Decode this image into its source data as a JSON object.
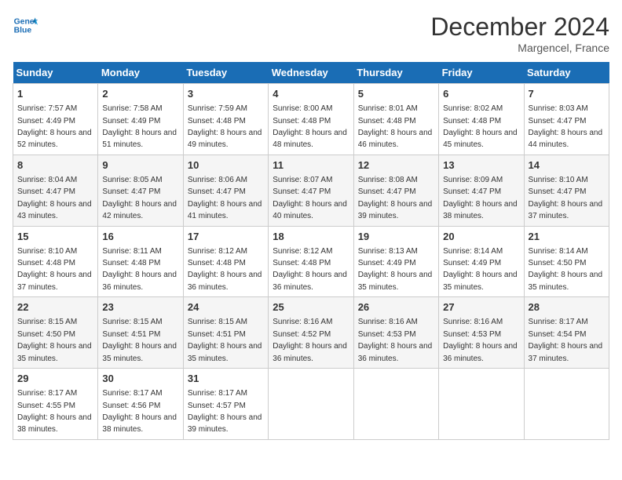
{
  "header": {
    "logo_line1": "General",
    "logo_line2": "Blue",
    "month": "December 2024",
    "location": "Margencel, France"
  },
  "weekdays": [
    "Sunday",
    "Monday",
    "Tuesday",
    "Wednesday",
    "Thursday",
    "Friday",
    "Saturday"
  ],
  "weeks": [
    [
      {
        "day": "1",
        "sunrise": "7:57 AM",
        "sunset": "4:49 PM",
        "daylight": "8 hours and 52 minutes."
      },
      {
        "day": "2",
        "sunrise": "7:58 AM",
        "sunset": "4:49 PM",
        "daylight": "8 hours and 51 minutes."
      },
      {
        "day": "3",
        "sunrise": "7:59 AM",
        "sunset": "4:48 PM",
        "daylight": "8 hours and 49 minutes."
      },
      {
        "day": "4",
        "sunrise": "8:00 AM",
        "sunset": "4:48 PM",
        "daylight": "8 hours and 48 minutes."
      },
      {
        "day": "5",
        "sunrise": "8:01 AM",
        "sunset": "4:48 PM",
        "daylight": "8 hours and 46 minutes."
      },
      {
        "day": "6",
        "sunrise": "8:02 AM",
        "sunset": "4:48 PM",
        "daylight": "8 hours and 45 minutes."
      },
      {
        "day": "7",
        "sunrise": "8:03 AM",
        "sunset": "4:47 PM",
        "daylight": "8 hours and 44 minutes."
      }
    ],
    [
      {
        "day": "8",
        "sunrise": "8:04 AM",
        "sunset": "4:47 PM",
        "daylight": "8 hours and 43 minutes."
      },
      {
        "day": "9",
        "sunrise": "8:05 AM",
        "sunset": "4:47 PM",
        "daylight": "8 hours and 42 minutes."
      },
      {
        "day": "10",
        "sunrise": "8:06 AM",
        "sunset": "4:47 PM",
        "daylight": "8 hours and 41 minutes."
      },
      {
        "day": "11",
        "sunrise": "8:07 AM",
        "sunset": "4:47 PM",
        "daylight": "8 hours and 40 minutes."
      },
      {
        "day": "12",
        "sunrise": "8:08 AM",
        "sunset": "4:47 PM",
        "daylight": "8 hours and 39 minutes."
      },
      {
        "day": "13",
        "sunrise": "8:09 AM",
        "sunset": "4:47 PM",
        "daylight": "8 hours and 38 minutes."
      },
      {
        "day": "14",
        "sunrise": "8:10 AM",
        "sunset": "4:47 PM",
        "daylight": "8 hours and 37 minutes."
      }
    ],
    [
      {
        "day": "15",
        "sunrise": "8:10 AM",
        "sunset": "4:48 PM",
        "daylight": "8 hours and 37 minutes."
      },
      {
        "day": "16",
        "sunrise": "8:11 AM",
        "sunset": "4:48 PM",
        "daylight": "8 hours and 36 minutes."
      },
      {
        "day": "17",
        "sunrise": "8:12 AM",
        "sunset": "4:48 PM",
        "daylight": "8 hours and 36 minutes."
      },
      {
        "day": "18",
        "sunrise": "8:12 AM",
        "sunset": "4:48 PM",
        "daylight": "8 hours and 36 minutes."
      },
      {
        "day": "19",
        "sunrise": "8:13 AM",
        "sunset": "4:49 PM",
        "daylight": "8 hours and 35 minutes."
      },
      {
        "day": "20",
        "sunrise": "8:14 AM",
        "sunset": "4:49 PM",
        "daylight": "8 hours and 35 minutes."
      },
      {
        "day": "21",
        "sunrise": "8:14 AM",
        "sunset": "4:50 PM",
        "daylight": "8 hours and 35 minutes."
      }
    ],
    [
      {
        "day": "22",
        "sunrise": "8:15 AM",
        "sunset": "4:50 PM",
        "daylight": "8 hours and 35 minutes."
      },
      {
        "day": "23",
        "sunrise": "8:15 AM",
        "sunset": "4:51 PM",
        "daylight": "8 hours and 35 minutes."
      },
      {
        "day": "24",
        "sunrise": "8:15 AM",
        "sunset": "4:51 PM",
        "daylight": "8 hours and 35 minutes."
      },
      {
        "day": "25",
        "sunrise": "8:16 AM",
        "sunset": "4:52 PM",
        "daylight": "8 hours and 36 minutes."
      },
      {
        "day": "26",
        "sunrise": "8:16 AM",
        "sunset": "4:53 PM",
        "daylight": "8 hours and 36 minutes."
      },
      {
        "day": "27",
        "sunrise": "8:16 AM",
        "sunset": "4:53 PM",
        "daylight": "8 hours and 36 minutes."
      },
      {
        "day": "28",
        "sunrise": "8:17 AM",
        "sunset": "4:54 PM",
        "daylight": "8 hours and 37 minutes."
      }
    ],
    [
      {
        "day": "29",
        "sunrise": "8:17 AM",
        "sunset": "4:55 PM",
        "daylight": "8 hours and 38 minutes."
      },
      {
        "day": "30",
        "sunrise": "8:17 AM",
        "sunset": "4:56 PM",
        "daylight": "8 hours and 38 minutes."
      },
      {
        "day": "31",
        "sunrise": "8:17 AM",
        "sunset": "4:57 PM",
        "daylight": "8 hours and 39 minutes."
      },
      null,
      null,
      null,
      null
    ]
  ],
  "labels": {
    "sunrise": "Sunrise:",
    "sunset": "Sunset:",
    "daylight": "Daylight:"
  }
}
